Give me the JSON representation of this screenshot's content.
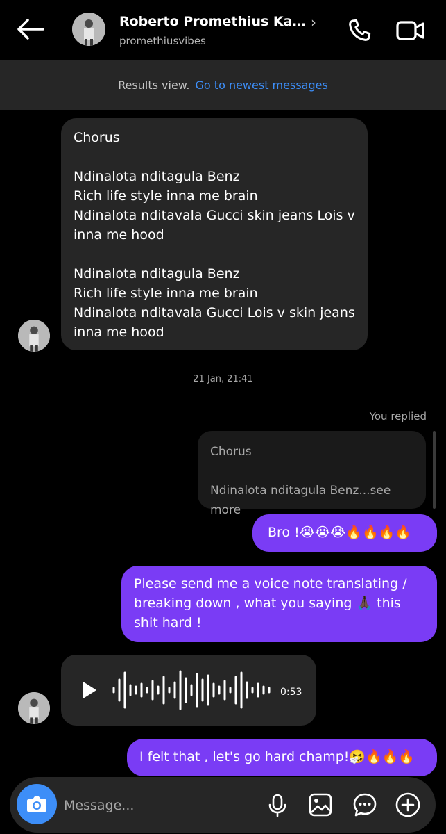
{
  "header": {
    "name": "Roberto Promethius Kadzu…",
    "username": "promethiusvibes",
    "chevron": "›"
  },
  "results_bar": {
    "label": "Results view.",
    "link": "Go to newest messages"
  },
  "messages": {
    "chorus": "Chorus\n\nNdinalota nditagula Benz\nRich life style inna me brain\nNdinalota nditavala Gucci skin jeans Lois v inna me hood\n\nNdinalota nditagula Benz\nRich life style inna me brain\nNdinalota nditavala Gucci Lois v skin jeans inna me hood",
    "timestamp": "21 Jan, 21:41",
    "you_replied": "You replied",
    "reply_quote": "Chorus\n\nNdinalota nditagula Benz...see more",
    "bro": "Bro !😭😭😭🔥🔥🔥🔥",
    "please": "Please send me a voice note translating / breaking down , what you saying 🙏🏿 this shit hard !",
    "voice_duration": "0:53",
    "felt": "I felt that , let's go hard champ!🤧🔥🔥🔥"
  },
  "composer": {
    "placeholder": "Message..."
  },
  "icons": {
    "back": "arrow-left-icon",
    "call": "phone-icon",
    "video": "video-camera-icon",
    "play": "play-icon",
    "camera": "camera-icon",
    "mic": "microphone-icon",
    "gallery": "image-icon",
    "sticker": "chat-bubble-icon",
    "plus": "plus-circle-icon"
  },
  "colors": {
    "background": "#000000",
    "incoming_bubble": "#262626",
    "outgoing_bubble": "#7a3cf5",
    "link": "#3d8ef8"
  }
}
